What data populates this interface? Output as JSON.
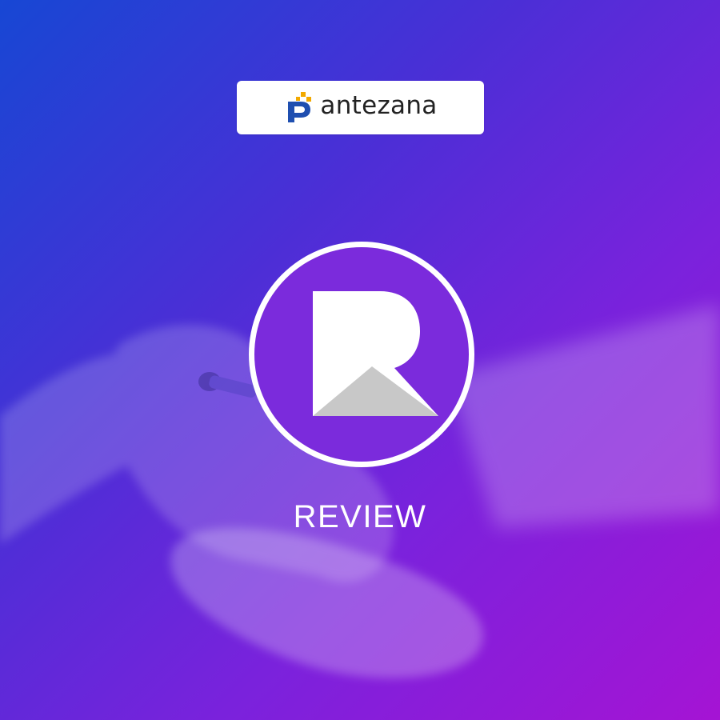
{
  "brand": {
    "name": "antezana",
    "logo_icon": "antezana-logo-icon",
    "mark_color": "#1f4fb0",
    "accent_color": "#f2a900"
  },
  "app_icon": {
    "icon": "r-letter-logo-icon",
    "circle_color": "#7b2bdc",
    "border_color": "#ffffff",
    "letter_color": "#ffffff",
    "shadow_color": "#c8c8c8"
  },
  "label": "REVIEW",
  "background": {
    "gradient_start": "#1747d4",
    "gradient_end": "#a514d4",
    "scene": "hand-on-mouse-photo"
  }
}
